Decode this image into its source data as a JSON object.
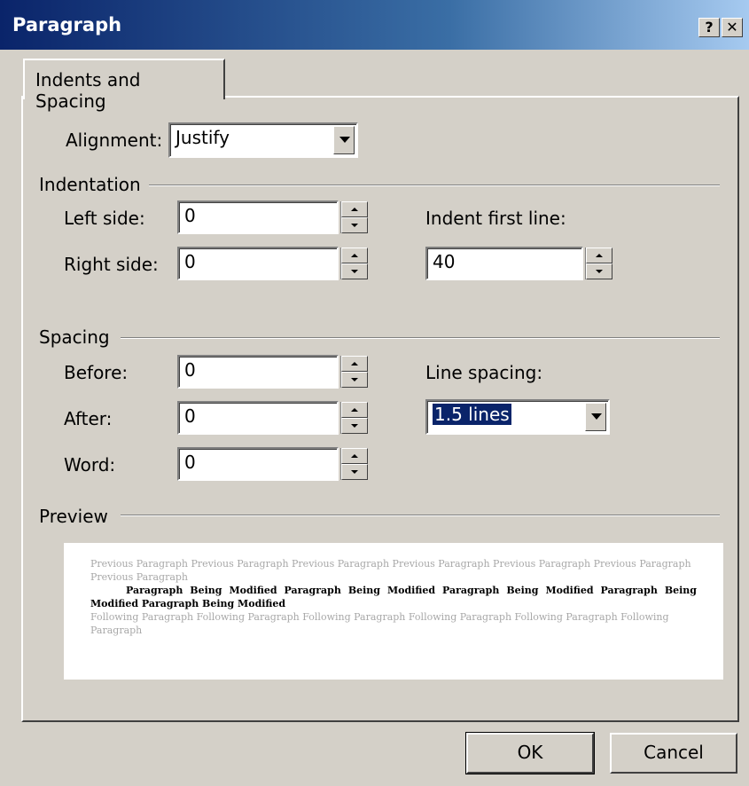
{
  "window": {
    "title": "Paragraph",
    "help_label": "?",
    "close_label": "✕"
  },
  "tabs": [
    {
      "label": "Indents and Spacing"
    }
  ],
  "alignment": {
    "label": "Alignment:",
    "value": "Justify"
  },
  "indentation": {
    "heading": "Indentation",
    "left_label": "Left side:",
    "left_value": "0",
    "right_label": "Right side:",
    "right_value": "0",
    "first_line_label": "Indent first line:",
    "first_line_value": "40"
  },
  "spacing": {
    "heading": "Spacing",
    "before_label": "Before:",
    "before_value": "0",
    "after_label": "After:",
    "after_value": "0",
    "word_label": "Word:",
    "word_value": "0",
    "line_spacing_label": "Line spacing:",
    "line_spacing_value": "1.5 lines"
  },
  "preview": {
    "heading": "Preview",
    "previous_text": "Previous Paragraph Previous Paragraph Previous Paragraph Previous Paragraph Previous Paragraph Previous Paragraph Previous Paragraph",
    "current_text": "Paragraph Being Modified Paragraph Being Modified Paragraph Being Modified Paragraph Being Modified Paragraph Being Modified",
    "following_text": "Following Paragraph Following Paragraph Following Paragraph Following Paragraph Following Paragraph Following Paragraph"
  },
  "buttons": {
    "ok": "OK",
    "cancel": "Cancel"
  }
}
